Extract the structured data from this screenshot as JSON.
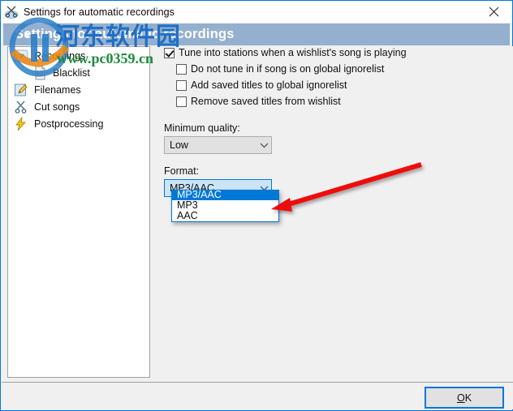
{
  "window": {
    "title": "Settings for automatic recordings",
    "title_icon": "scissors-tools-icon",
    "close_icon": "close-icon",
    "header_band_title": "Settings for automatic recordings",
    "header_band_color": "#95b0cf",
    "accent_color": "#0078d7",
    "background_color": "#f0f0f0"
  },
  "sidebar": {
    "items": [
      {
        "label": "Recordings",
        "icon": "broadcast-antenna-icon",
        "indent": false
      },
      {
        "label": "Blacklist",
        "icon": "document-list-icon",
        "indent": true
      },
      {
        "label": "Filenames",
        "icon": "pencil-edit-icon",
        "indent": false
      },
      {
        "label": "Cut songs",
        "icon": "scissors-icon",
        "indent": false
      },
      {
        "label": "Postprocessing",
        "icon": "lightning-bolt-icon",
        "indent": false
      }
    ]
  },
  "content": {
    "checkboxes": [
      {
        "label": "Tune into stations when a wishlist's song is playing",
        "checked": true,
        "sub": false
      },
      {
        "label": "Do not tune in if song is on global ignorelist",
        "checked": false,
        "sub": true
      },
      {
        "label": "Add saved titles to global ignorelist",
        "checked": false,
        "sub": true
      },
      {
        "label": "Remove saved titles from wishlist",
        "checked": false,
        "sub": true
      }
    ],
    "quality": {
      "label": "Minimum quality:",
      "value": "Low"
    },
    "format": {
      "label": "Format:",
      "value": "MP3/AAC",
      "options": [
        "MP3/AAC",
        "MP3",
        "AAC"
      ],
      "selected_index": 0,
      "expanded": true
    }
  },
  "footer": {
    "ok_accel": "O",
    "ok_rest": "K"
  },
  "annotation": {
    "arrow_color": "#ee1111"
  },
  "watermark": {
    "chinese_text": "河东软件园",
    "url_text": "www.pc0359.cn",
    "logo": "circle-logo-icon"
  }
}
